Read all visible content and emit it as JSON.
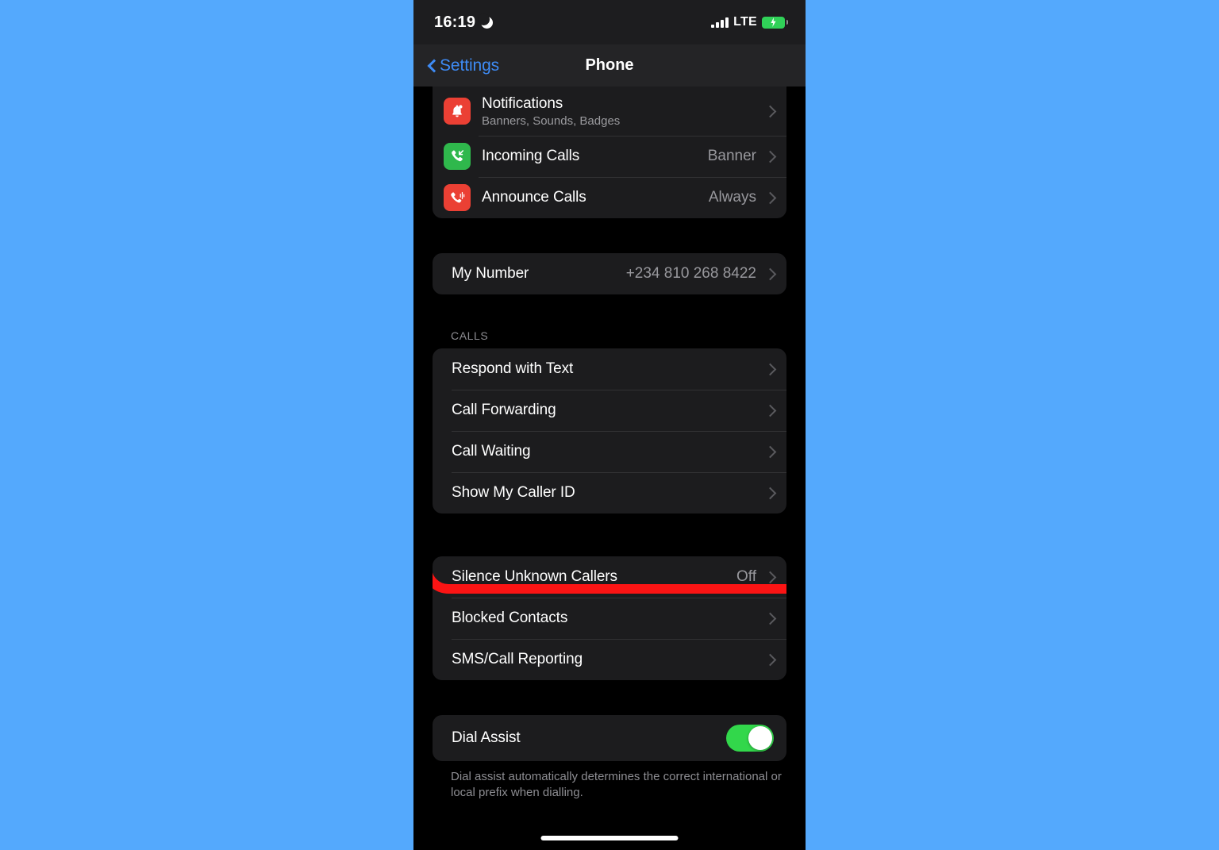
{
  "status_bar": {
    "time": "16:19",
    "moon_icon": "crescent-moon-icon",
    "signal_icon": "cellular-signal-icon",
    "network": "LTE",
    "battery_icon": "battery-charging-icon"
  },
  "nav": {
    "back_label": "Settings",
    "back_icon": "chevron-left-icon",
    "title": "Phone"
  },
  "sections": {
    "notifications_group": [
      {
        "title": "Notifications",
        "subtitle": "Banners, Sounds, Badges",
        "value": "",
        "icon": "bell-icon"
      },
      {
        "title": "Incoming Calls",
        "subtitle": "",
        "value": "Banner",
        "icon": "incoming-call-icon"
      },
      {
        "title": "Announce Calls",
        "subtitle": "",
        "value": "Always",
        "icon": "announce-call-icon"
      }
    ],
    "my_number": {
      "title": "My Number",
      "value": "+234 810 268 8422"
    },
    "calls_header": "CALLS",
    "calls_group": [
      {
        "title": "Respond with Text",
        "value": ""
      },
      {
        "title": "Call Forwarding",
        "value": ""
      },
      {
        "title": "Call Waiting",
        "value": ""
      },
      {
        "title": "Show My Caller ID",
        "value": ""
      }
    ],
    "silence_group": [
      {
        "title": "Silence Unknown Callers",
        "value": "Off"
      },
      {
        "title": "Blocked Contacts",
        "value": ""
      },
      {
        "title": "SMS/Call Reporting",
        "value": ""
      }
    ],
    "dial_assist": {
      "title": "Dial Assist",
      "toggle_state": "on",
      "footnote": "Dial assist automatically determines the correct international or local prefix when dialling."
    }
  },
  "annotation": {
    "highlight_color": "#fb1414",
    "highlight_target": "Silence Unknown Callers"
  },
  "colors": {
    "page_background": "#54a9fd",
    "screen_background": "#000000",
    "card_background": "#1c1c1e",
    "accent_blue": "#3e8bf5",
    "toggle_green": "#32d74b",
    "icon_red": "#eb4034",
    "icon_green": "#2fb84c"
  }
}
